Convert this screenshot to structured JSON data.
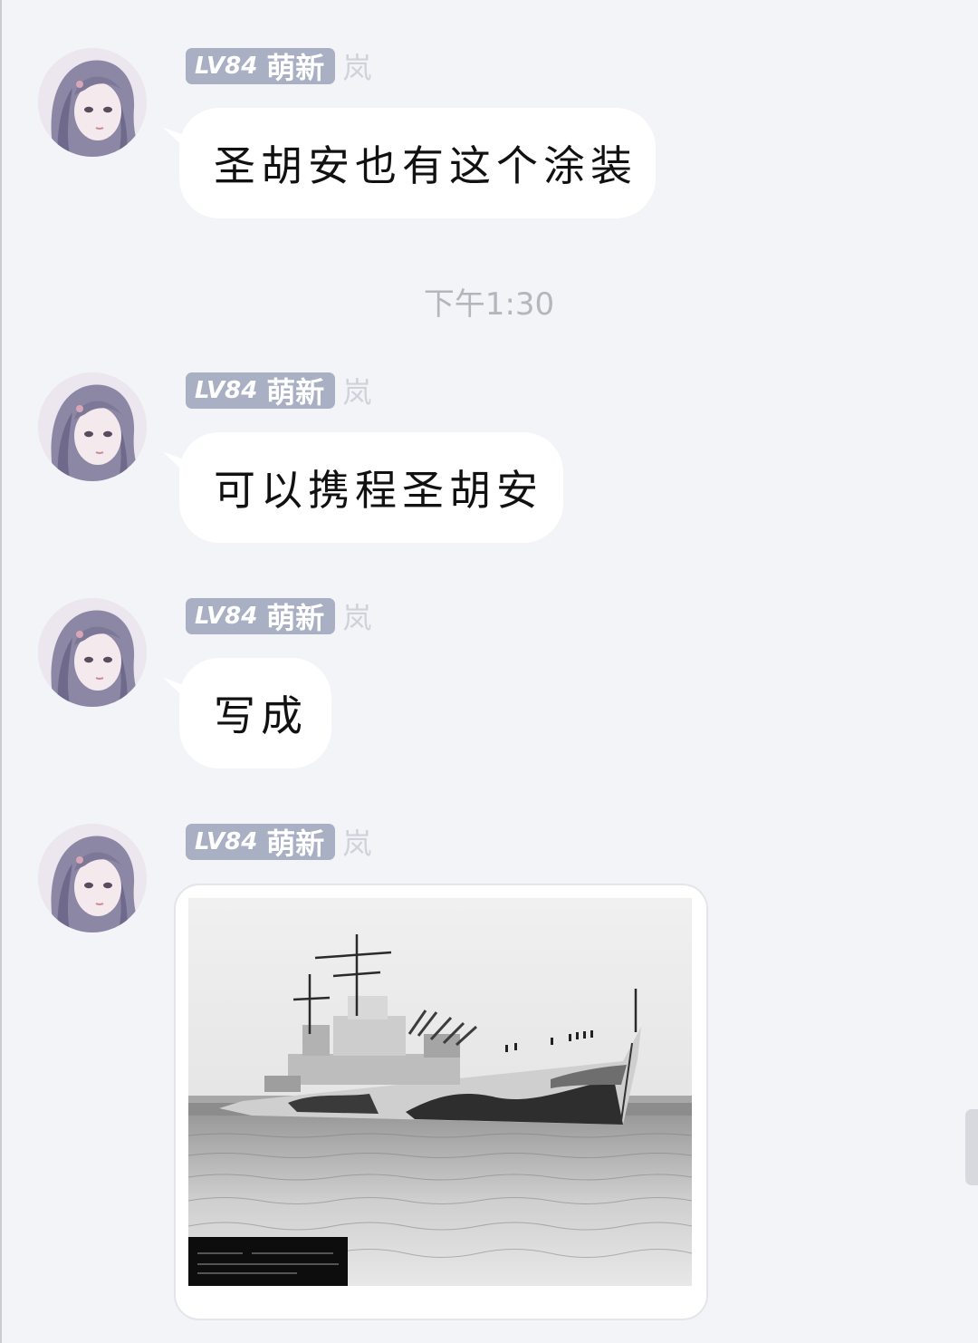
{
  "messages": [
    {
      "level_prefix": "LV",
      "level_num": "84",
      "badge_title": "萌新",
      "nickname": "岚",
      "text": "圣胡安也有这个涂装"
    },
    {
      "level_prefix": "LV",
      "level_num": "84",
      "badge_title": "萌新",
      "nickname": "岚",
      "text": "可以携程圣胡安"
    },
    {
      "level_prefix": "LV",
      "level_num": "84",
      "badge_title": "萌新",
      "nickname": "岚",
      "text": "写成"
    },
    {
      "level_prefix": "LV",
      "level_num": "84",
      "badge_title": "萌新",
      "nickname": "岚",
      "image_alt": "ship-photo"
    }
  ],
  "timestamp": "下午1:30",
  "colors": {
    "background": "#f3f4f8",
    "bubble": "#ffffff",
    "badge": "#a9b0c4",
    "nickname": "#cfd2d9",
    "timestamp": "#b3b6bd"
  }
}
